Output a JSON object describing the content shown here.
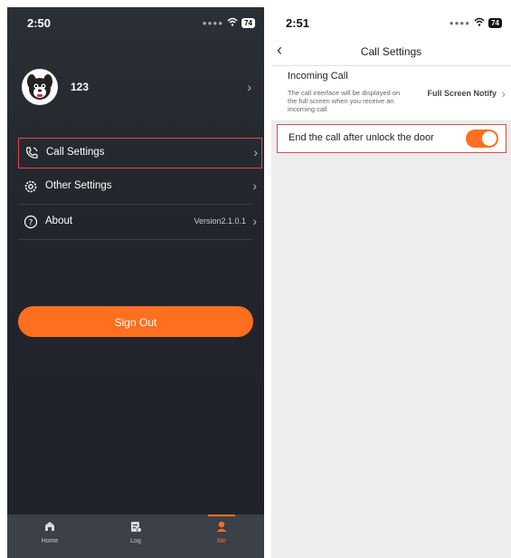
{
  "left": {
    "status": {
      "time": "2:50",
      "battery": "74"
    },
    "user": {
      "name": "123"
    },
    "menu": [
      {
        "label": "Call Settings",
        "value": ""
      },
      {
        "label": "Other Settings",
        "value": ""
      },
      {
        "label": "About",
        "value": "Version2.1.0.1"
      }
    ],
    "sign_out": "Sign Out",
    "tabs": [
      {
        "label": "Home"
      },
      {
        "label": "Log"
      },
      {
        "label": "Me"
      }
    ]
  },
  "right": {
    "status": {
      "time": "2:51",
      "battery": "74"
    },
    "nav_title": "Call Settings",
    "incoming": {
      "title": "Incoming Call",
      "description": "The call interface will be displayed on the full screen when you receive an incoming call",
      "value": "Full Screen Notify"
    },
    "end_call": {
      "label": "End the call after unlock the door",
      "enabled": true
    }
  },
  "colors": {
    "accent": "#ff6f1f",
    "highlight": "#d94b4b",
    "dark_bg": "#22262c"
  }
}
